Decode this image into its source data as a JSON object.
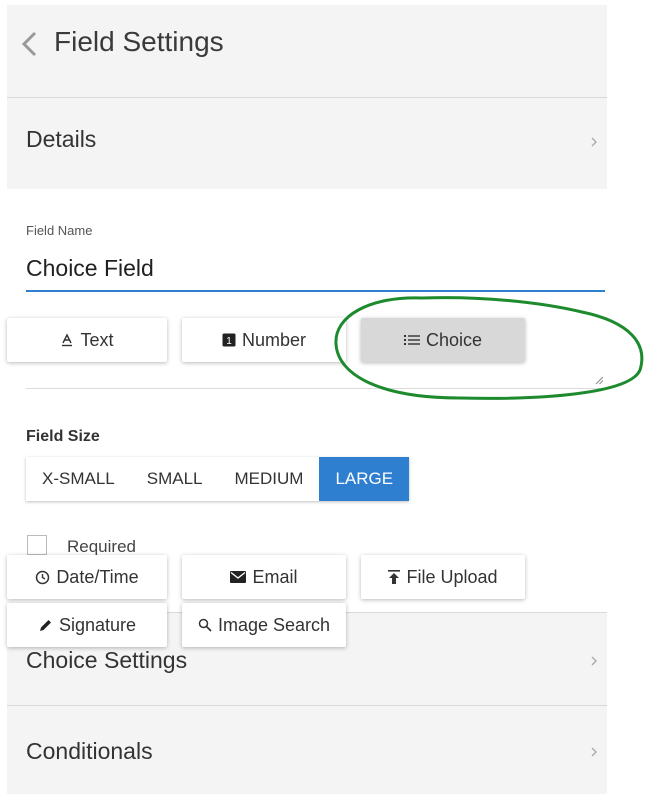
{
  "header": {
    "title": "Field Settings"
  },
  "sections": {
    "details": "Details",
    "choice_settings": "Choice Settings",
    "conditionals": "Conditionals"
  },
  "field_name": {
    "label": "Field Name",
    "value": "Choice Field"
  },
  "field_types_row1": [
    {
      "label": "Text",
      "icon": "text-icon"
    },
    {
      "label": "Number",
      "icon": "number-icon"
    },
    {
      "label": "Choice",
      "icon": "list-icon",
      "selected": true
    }
  ],
  "field_size": {
    "label": "Field Size",
    "options": [
      "X-SMALL",
      "SMALL",
      "MEDIUM",
      "LARGE"
    ],
    "selected": "LARGE"
  },
  "required": {
    "label": "Required",
    "checked": false
  },
  "field_types_row2": [
    {
      "label": "Date/Time",
      "icon": "clock-icon"
    },
    {
      "label": "Email",
      "icon": "envelope-icon"
    },
    {
      "label": "File Upload",
      "icon": "upload-icon"
    }
  ],
  "field_types_row3": [
    {
      "label": "Signature",
      "icon": "pencil-icon"
    },
    {
      "label": "Image Search",
      "icon": "search-icon"
    }
  ],
  "colors": {
    "accent": "#2f7fd0",
    "annotation": "#1e8a2e",
    "panel_bg": "#f4f4f4",
    "selected_chip": "#d8d8d8"
  }
}
